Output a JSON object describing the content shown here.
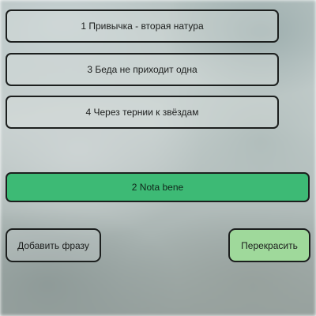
{
  "phrases": [
    {
      "label": "1 Привычка - вторая натура"
    },
    {
      "label": "3 Беда не приходит одна"
    },
    {
      "label": "4 Через тернии к звёздам"
    }
  ],
  "selected_phrase": {
    "label": "2 Nota bene",
    "color": "#3dba75"
  },
  "actions": {
    "add_phrase_label": "Добавить фразу",
    "recolor_label": "Перекрасить",
    "recolor_color": "#9fd99b"
  }
}
